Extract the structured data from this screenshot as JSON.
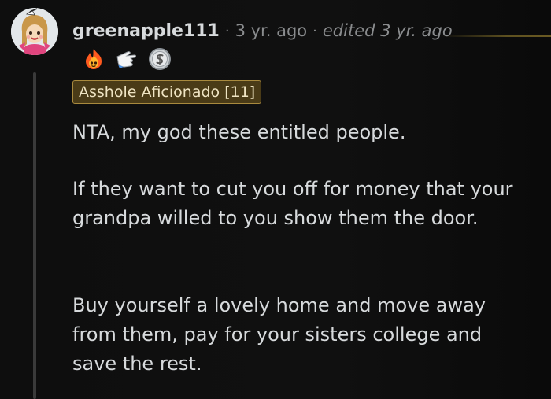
{
  "comment": {
    "username": "greenapple111",
    "age": "3 yr. ago",
    "separator": "·",
    "edited": "edited 3 yr. ago",
    "awards": [
      "fire-award-icon",
      "pointing-hand-award-icon",
      "silver-coin-award-icon"
    ],
    "flair": "Asshole Aficionado [11]",
    "paragraphs": [
      "NTA, my god these entitled people.",
      "If they want to cut you off for money that your grandpa willed to you show them the door.",
      "Buy yourself a lovely home and move away from them, pay for your sisters college and save the rest."
    ]
  },
  "colors": {
    "background": "#0b0b0b",
    "text": "#d7dadc",
    "meta": "#8a8c8e",
    "flair_bg": "#4a3b17",
    "flair_border": "#a98a3e",
    "flair_text": "#efe4c3",
    "thread_line": "#3a3a3a"
  }
}
